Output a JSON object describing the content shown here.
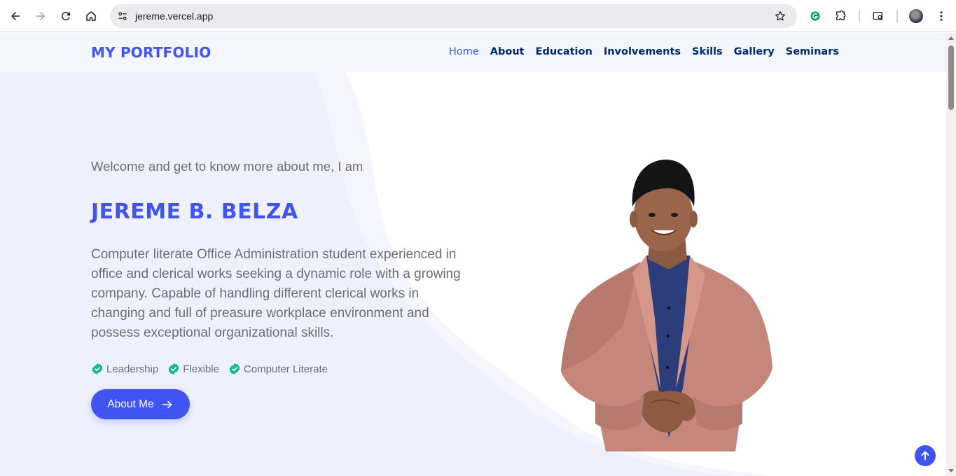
{
  "browser": {
    "url": "jereme.vercel.app",
    "icons": [
      "back-icon",
      "forward-icon",
      "reload-icon",
      "home-icon",
      "site-settings-icon",
      "bookmark-star-icon",
      "grammarly-icon",
      "extensions-icon",
      "tab-search-icon",
      "profile-avatar",
      "menu-icon"
    ]
  },
  "navbar": {
    "brand": "MY PORTFOLIO",
    "items": [
      {
        "label": "Home",
        "active": true
      },
      {
        "label": "About"
      },
      {
        "label": "Education"
      },
      {
        "label": "Involvements"
      },
      {
        "label": "Skills"
      },
      {
        "label": "Gallery"
      },
      {
        "label": "Seminars"
      }
    ]
  },
  "hero": {
    "welcome": "Welcome and get to know more about me, I am",
    "name": "JEREME B. BELZA",
    "summary": "Computer literate Office Administration student experienced in office and clerical works seeking a dynamic role with a growing company. Capable of handling different clerical works in changing and full of preasure workplace environment and possess exceptional organizational skills.",
    "tags": [
      "Leadership",
      "Flexible",
      "Computer Literate"
    ],
    "button_label": "About Me"
  },
  "colors": {
    "accent": "#4154f1",
    "nav_text": "#012970",
    "check": "#0ebc8a",
    "body_text": "#6b6e78"
  }
}
